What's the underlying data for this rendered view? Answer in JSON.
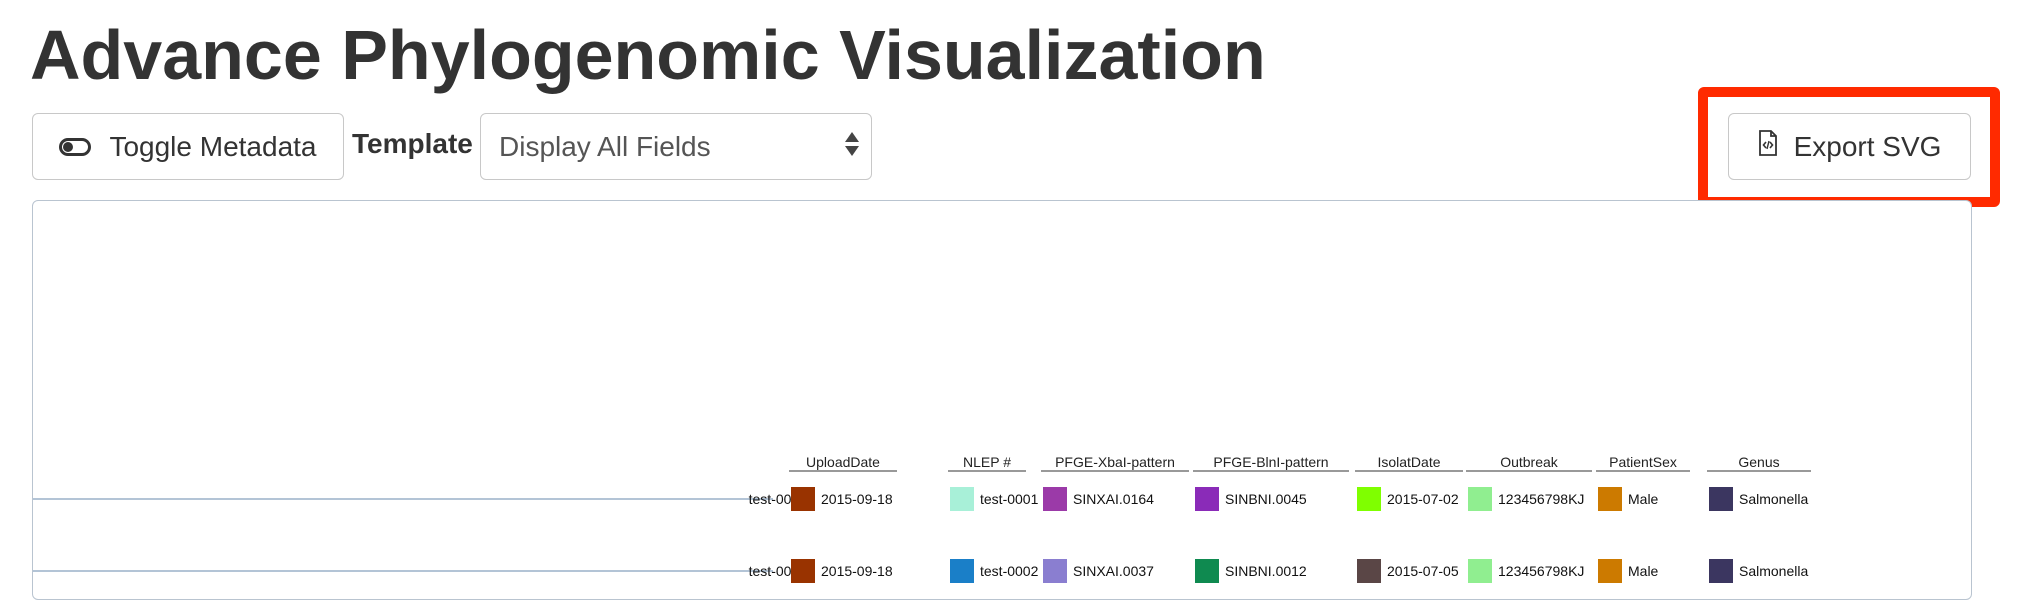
{
  "page": {
    "title": "Advance Phylogenomic Visualization"
  },
  "toolbar": {
    "toggle_label": "Toggle Metadata",
    "template_label": "Template",
    "template_select": {
      "selected": "Display All Fields"
    },
    "export_label": "Export SVG"
  },
  "colors": {
    "highlight": "#ff2a00",
    "branch": "#9ab0c8"
  },
  "tree": {
    "columns": [
      "UploadDate",
      "NLEP #",
      "PFGE-XbaI-pattern",
      "PFGE-BlnI-pattern",
      "IsolatDate",
      "Outbreak",
      "PatientSex",
      "Genus"
    ],
    "rows": [
      {
        "label": "test-0001",
        "cells": [
          {
            "text": "2015-09-18",
            "color": "#993300"
          },
          {
            "text": "test-0001",
            "color": "#a8f0d8"
          },
          {
            "text": "SINXAI.0164",
            "color": "#9b3aa8"
          },
          {
            "text": "SINBNI.0045",
            "color": "#8a2bb8"
          },
          {
            "text": "2015-07-02",
            "color": "#7fff00"
          },
          {
            "text": "123456798KJ",
            "color": "#90ee90"
          },
          {
            "text": "Male",
            "color": "#cc7a00"
          },
          {
            "text": "Salmonella",
            "color": "#3b3660"
          }
        ]
      },
      {
        "label": "test-0002",
        "cells": [
          {
            "text": "2015-09-18",
            "color": "#993300"
          },
          {
            "text": "test-0002",
            "color": "#1a7fc8"
          },
          {
            "text": "SINXAI.0037",
            "color": "#8a7ed0"
          },
          {
            "text": "SINBNI.0012",
            "color": "#0f8a50"
          },
          {
            "text": "2015-07-05",
            "color": "#5a4646"
          },
          {
            "text": "123456798KJ",
            "color": "#90ee90"
          },
          {
            "text": "Male",
            "color": "#cc7a00"
          },
          {
            "text": "Salmonella",
            "color": "#3b3660"
          }
        ]
      }
    ]
  }
}
